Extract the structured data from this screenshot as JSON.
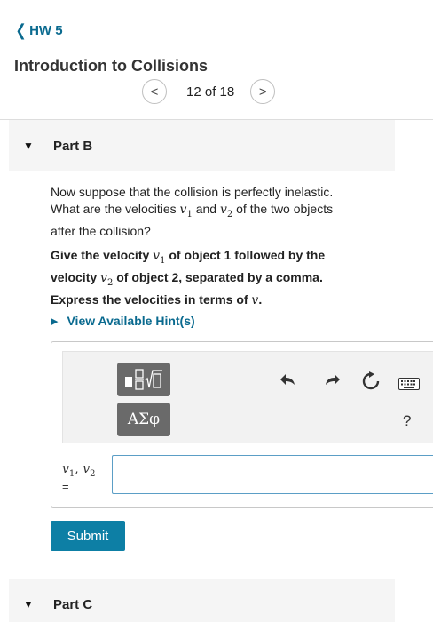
{
  "nav": {
    "back_label": "HW 5"
  },
  "header": {
    "title": "Introduction to Collisions",
    "pager_text": "12 of 18"
  },
  "parts": [
    {
      "label": "Part B"
    },
    {
      "label": "Part C"
    }
  ],
  "question": {
    "line1": "Now suppose that the collision is perfectly inelastic.",
    "line2_pre": "What are the velocities ",
    "v1": "v",
    "v1_sub": "1",
    "and": " and ",
    "v2": "v",
    "v2_sub": "2",
    "line2_post": " of the two objects",
    "line3": "after the collision?"
  },
  "instructions": {
    "p1": "Give the velocity ",
    "v1": "v",
    "v1_sub": "1",
    "p2": " of object 1 followed by the",
    "p3": "velocity ",
    "v2": "v",
    "v2_sub": "2",
    "p4": " of object 2, separated by a comma.",
    "p5": "Express the velocities in terms of ",
    "v": "v",
    "p6": "."
  },
  "hints": {
    "label": "View Available Hint(s)"
  },
  "toolbar": {
    "symbol_label": "ΑΣφ",
    "help_label": "?",
    "icons": [
      "templates-icon",
      "undo-icon",
      "redo-icon",
      "reset-icon",
      "keyboard-icon",
      "help-icon"
    ]
  },
  "answer": {
    "label": "v1, v2",
    "label_v1": "v",
    "label_sub1": "1",
    "label_sep": ", ",
    "label_v2": "v",
    "label_sub2": "2",
    "equals": "=",
    "value": "",
    "placeholder": ""
  },
  "submit": {
    "label": "Submit"
  },
  "colors": {
    "link": "#0a6a8f",
    "submit": "#0d7fa5",
    "input_border": "#5b9ec6",
    "toolbar_button": "#6a6a6a"
  }
}
